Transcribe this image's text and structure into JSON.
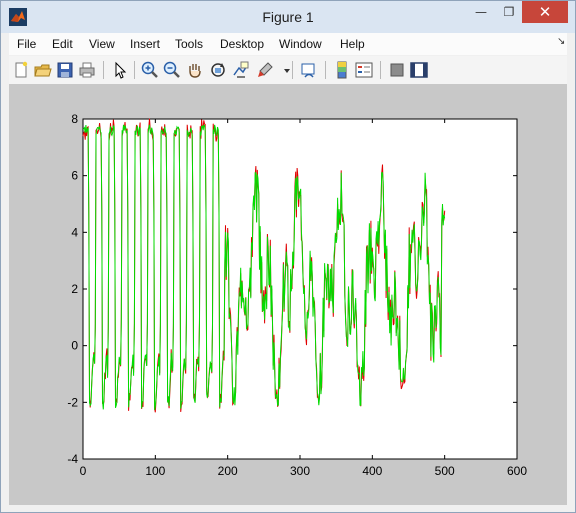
{
  "window": {
    "title": "Figure 1",
    "close_glyph": "✕",
    "minimize_glyph": "—",
    "maximize_glyph": "❐",
    "dock_glyph": "↘"
  },
  "menu": [
    "File",
    "Edit",
    "View",
    "Insert",
    "Tools",
    "Desktop",
    "Window",
    "Help"
  ],
  "toolbar": [
    "new-figure-icon",
    "open-file-icon",
    "save-icon",
    "print-icon",
    "edit-plot-arrow-icon",
    "zoom-in-icon",
    "zoom-out-icon",
    "pan-hand-icon",
    "rotate-3d-icon",
    "data-cursor-icon",
    "brush-icon",
    "link-plot-icon",
    "colorbar-icon",
    "legend-icon",
    "hide-plot-tools-icon",
    "show-plot-tools-icon"
  ],
  "colors": {
    "series_red": "#e00000",
    "series_green": "#00dd00",
    "figure_bg": "#c8c8c8",
    "axes_bg": "#ffffff"
  },
  "chart_data": {
    "type": "line",
    "xlim": [
      0,
      600
    ],
    "ylim": [
      -4,
      8
    ],
    "xticks": [
      "0",
      "100",
      "200",
      "300",
      "400",
      "500",
      "600"
    ],
    "yticks": [
      "-4",
      "-2",
      "0",
      "2",
      "4",
      "6",
      "8"
    ],
    "grid": false,
    "series": [
      {
        "color": "red",
        "x": [
          0,
          500
        ]
      },
      {
        "color": "green",
        "x": [
          0,
          500
        ]
      }
    ],
    "segments": [
      {
        "x_from": 0,
        "x_to": 195,
        "pattern": "periodic square-like wave",
        "period": 18,
        "y_min": -2.3,
        "y_max": 7.8
      },
      {
        "x_from": 195,
        "x_to": 500,
        "pattern": "irregular oscillation",
        "y_min": -2.1,
        "y_max": 6.1,
        "last_y": 4.5
      }
    ]
  }
}
